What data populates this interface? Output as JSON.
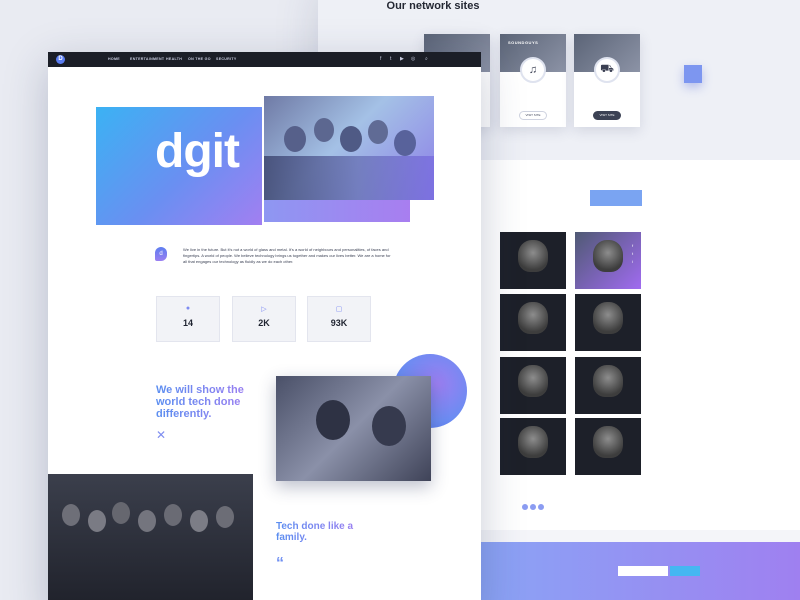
{
  "network": {
    "title": "Our network sites",
    "subtitle": "",
    "sites": [
      {
        "brand": "",
        "desc": "",
        "visit": ""
      },
      {
        "brand": "SOUNDGUYS",
        "desc": "",
        "visit": "VISIT SITE"
      },
      {
        "brand": "",
        "desc": "",
        "visit": "VISIT SITE"
      }
    ]
  },
  "team": {
    "heading": "",
    "subheading": "",
    "button": "",
    "members": [
      {
        "name": "",
        "role": ""
      },
      {
        "name": "",
        "role": ""
      },
      {
        "name": "",
        "role": ""
      },
      {
        "name": "",
        "role": ""
      },
      {
        "name": "",
        "role": ""
      },
      {
        "name": "",
        "role": ""
      },
      {
        "name": "",
        "role": ""
      },
      {
        "name": "",
        "role": ""
      }
    ]
  },
  "subscribe": {
    "label": "",
    "placeholder": ""
  },
  "nav": {
    "logo": "D",
    "items": [
      "HOME",
      "ENTERTAINMENT",
      "HEALTH",
      "ON THE GO",
      "SECURITY"
    ]
  },
  "hero": {
    "wordmark": "dgit",
    "tagline": ""
  },
  "intro": {
    "text": "We live in the future. But it's not a world of glass and metal. It's a world of neighbours and personalities, of faces and fingertips. A world of people. We believe technology brings us together and makes our lives better. We are a home for all that engages our technology as fluidly as we do each other."
  },
  "stats": [
    {
      "value": "14",
      "label": ""
    },
    {
      "value": "2K",
      "label": ""
    },
    {
      "value": "93K",
      "label": ""
    }
  ],
  "mission": {
    "kicker": "",
    "heading": "We will show the world tech done differently.",
    "text": ""
  },
  "family": {
    "kicker": "",
    "heading": "Tech done like a family.",
    "quote": "",
    "author": ""
  }
}
